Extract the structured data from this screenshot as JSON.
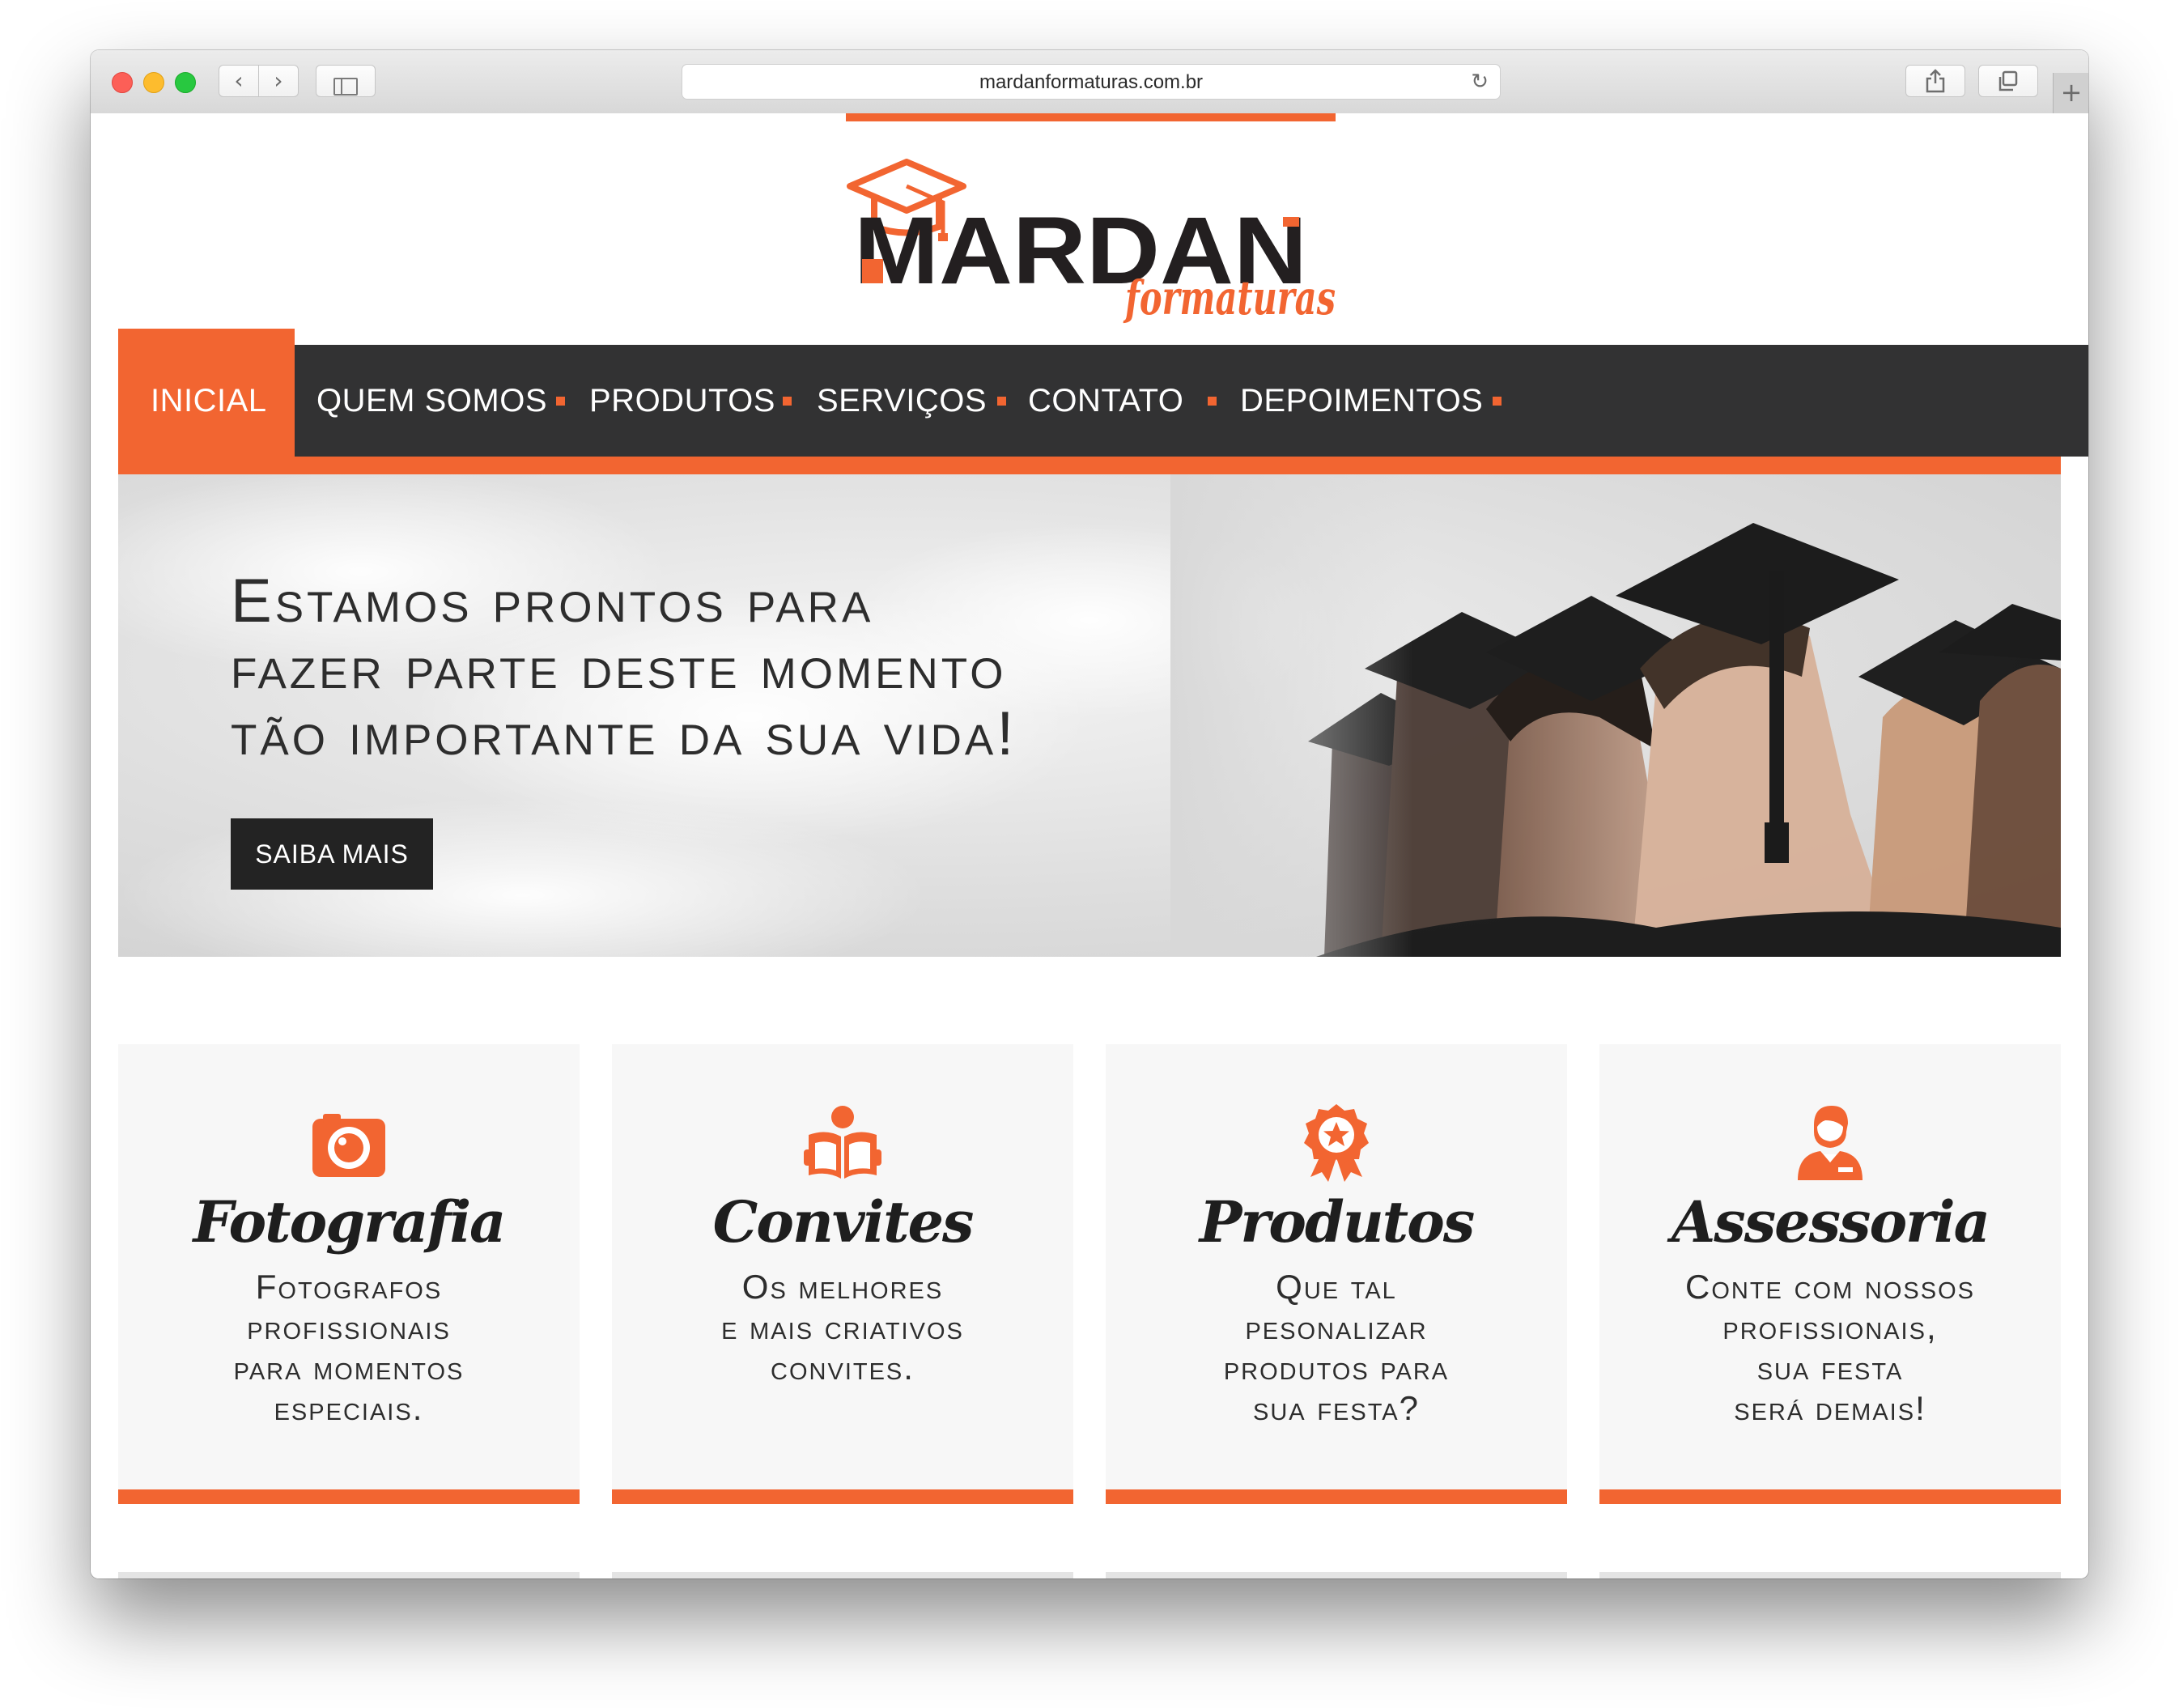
{
  "browser": {
    "url": "mardanformaturas.com.br"
  },
  "site": {
    "logo": {
      "brand": "MARDAN",
      "tagline": "formaturas"
    },
    "nav": {
      "items": [
        "INICIAL",
        "QUEM SOMOS",
        "PRODUTOS",
        "SERVIÇOS",
        "CONTATO",
        "DEPOIMENTOS"
      ],
      "active_index": 0
    },
    "hero": {
      "lines": [
        "Estamos prontos para",
        "fazer parte deste momento",
        "tão importante da sua vida!"
      ],
      "button_label": "SAIBA MAIS"
    },
    "cards": [
      {
        "icon": "camera-icon",
        "title": "Fotografia",
        "lines": [
          "Fotografos",
          "profissionais",
          "para momentos",
          "especiais."
        ]
      },
      {
        "icon": "book-icon",
        "title": "Convites",
        "lines": [
          "Os melhores",
          "e mais criativos",
          "convites."
        ]
      },
      {
        "icon": "award-icon",
        "title": "Produtos",
        "lines": [
          "Que tal",
          "pesonalizar",
          "produtos para",
          "sua festa?"
        ]
      },
      {
        "icon": "user-icon",
        "title": "Assessoria",
        "lines": [
          "Conte com nossos",
          "profissionais,",
          "sua festa",
          "será demais!"
        ]
      }
    ]
  },
  "colors": {
    "accent": "#f26531",
    "nav_bg": "#323233",
    "button_bg": "#232323",
    "card_bg": "#f7f7f7"
  }
}
